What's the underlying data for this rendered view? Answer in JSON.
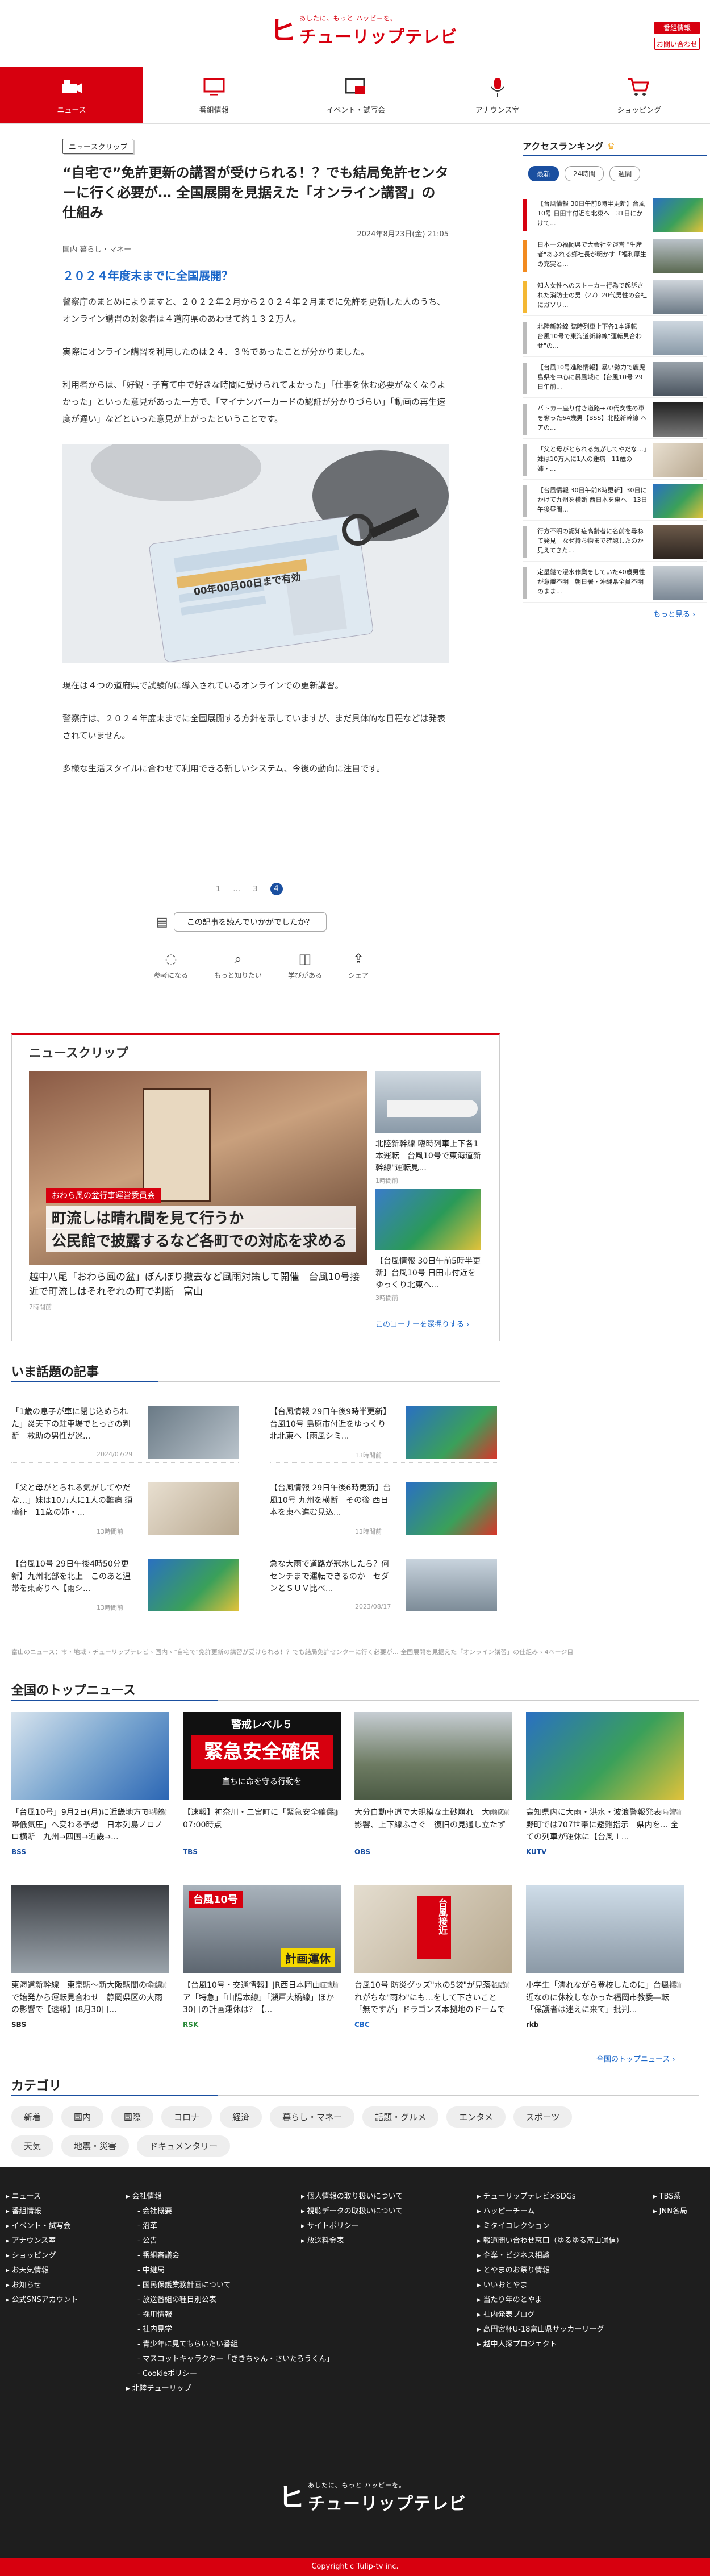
{
  "header": {
    "tagline": "あしたに、もっと ハッピーを。",
    "logo": "チューリップテレビ",
    "btn_newmember": "番組情報",
    "btn_inquiry": "お問い合わせ"
  },
  "nav": [
    {
      "label": "ニュース",
      "icon": "camera-icon"
    },
    {
      "label": "番組情報",
      "icon": "tv-icon"
    },
    {
      "label": "イベント・試写会",
      "icon": "event-icon"
    },
    {
      "label": "アナウンス室",
      "icon": "microphone-icon"
    },
    {
      "label": "ショッピング",
      "icon": "cart-icon"
    }
  ],
  "article": {
    "badge": "ニュースクリップ",
    "title": "“自宅で”免許更新の講習が受けられる！？でも結局免許センターに行く必要が… 全国展開を見据えた「オンライン講習」の仕組み",
    "date": "2024年8月23日(金) 21:05",
    "categories": "国内  暮らし・マネー",
    "subheading": "２０２４年度末までに全国展開？",
    "p1": "警察庁のまとめによりますと、２０２２年２月から２０２４年２月までに免許を更新した人のうち、オンライン講習の対象者は４道府県のあわせて約１３２万人。",
    "p2": "実際にオンライン講習を利用したのは２４．３％であったことが分かりました。",
    "p3": "利用者からは、「好観・子育て中で好きな時間に受けられてよかった」「仕事を休む必要がなくなりよかった」といった意見があった一方で、「マイナンバーカードの認証が分かりづらい」「動画の再生速度が遅い」などといった意見が上がったということです。",
    "p4": "現在は４つの道府県で試験的に導入されているオンラインでの更新講習。",
    "p5": "警察庁は、２０２４年度末までに全国展開する方針を示していますが、まだ具体的な日程などは発表されていません。",
    "p6": "多様な生活スタイルに合わせて利用できる新しいシステム、今後の動向に注目です。",
    "license_text": "00年00月00日まで有効"
  },
  "pager": {
    "p1": "1",
    "dots": "…",
    "p3": "3",
    "p4": "4"
  },
  "feedback": {
    "question": "この記事を読んでいかがでしたか？",
    "reactions": [
      {
        "label": "参考になる",
        "icon": "lightbulb-icon"
      },
      {
        "label": "もっと知りたい",
        "icon": "magnifier-icon"
      },
      {
        "label": "学びがある",
        "icon": "book-icon"
      },
      {
        "label": "シェア",
        "icon": "share-icon"
      }
    ]
  },
  "clip": {
    "title": "ニュースクリップ",
    "main_overlay_tag": "おわら風の盆行事運営委員会",
    "main_overlay1": "町流しは晴れ間を見て行うか",
    "main_overlay2": "公民館で披露するなど各町での対応を求める",
    "main_caption": "越中八尾「おわら風の盆」ぼんぼり撤去など風雨対策して開催　台風10号接近で町流しはそれぞれの町で判断　富山",
    "main_ts": "7時間前",
    "side1_caption": "北陸新幹線 臨時列車上下各1本運転　台風10号で東海道新幹線\"運転見...",
    "side1_ts": "1時間前",
    "side2_caption": "【台風情報 30日午前5時半更新】台風10号 日田市付近をゆっくり北東へ...",
    "side2_ts": "3時間前",
    "more": "このコーナーを深掘りする ›"
  },
  "trending": {
    "title": "いま話題の記事",
    "items": [
      {
        "t": "「1歳の息子が車に閉じ込められた」炎天下の駐車場でとっさの判断　救助の男性が迷...",
        "ts": "2024/07/29"
      },
      {
        "t": "【台風情報 29日午後9時半更新】台風10号 島原市付近をゆっくり北北東へ【雨風シミ...",
        "ts": "13時間前"
      },
      {
        "t": "「父と母がとられる気がしてやだな…」妹は10万人に1人の難病 須藤征　11歳の姉・...",
        "ts": "13時間前"
      },
      {
        "t": "【台風情報 29日午後6時更新】台風10号 九州を横断　その後 西日本を東へ進む見込...",
        "ts": "13時間前"
      },
      {
        "t": "【台風10号 29日午後4時50分更新】九州北部を北上　このあと温帯を東寄りへ【雨シ...",
        "ts": "13時間前"
      },
      {
        "t": "急な大雨で道路が冠水したら？何センチまで運転できるのか　セダンとＳＵＶ比べ...",
        "ts": "2023/08/17"
      }
    ]
  },
  "breadcrumb": "富山のニュース：市・地域 › チューリップテレビ › 国内 › \"自宅で\"免許更新の講習が受けられる！？でも結局免許センターに行く必要が… 全国展開を見据えた「オンライン講習」の仕組み › 4ページ目",
  "topnews": {
    "title": "全国のトップニュース",
    "items": [
      {
        "t": "「台風10号」9月2日(月)に近畿地方で「熱帯低気圧」へ変わる予想　日本列島ノロノロ横断　九州→四国→近畿→...",
        "src": "BSS",
        "ts": "3時間前"
      },
      {
        "t": "【速報】神奈川・二宮町に「緊急安全確保」07:00時点",
        "src": "TBS",
        "ts": "2時間前",
        "overlay1": "警戒レベル５",
        "overlay2": "緊急安全確保",
        "overlay3": "直ちに命を守る行動を"
      },
      {
        "t": "大分自動車道で大規模な土砂崩れ　大雨の影響、上下線ふさぐ　復旧の見通し立たず",
        "src": "OBS",
        "ts": "1時間前"
      },
      {
        "t": "高知県内に大雨・洪水・波浪警報発表 - 津野町では707世帯に避難指示　県内を... 全ての列車が運休に【台風１...",
        "src": "KUTV",
        "ts": "1時間前"
      },
      {
        "t": "東海道新幹線　東京駅〜新大阪駅間の全線で始発から運転見合わせ　静岡県区の大雨の影響で【速報】(8月30日...",
        "src": "SBS",
        "ts": "1時間前"
      },
      {
        "t": "【台風10号・交通情報】JR西日本岡山エリア「特急」「山陽本線」「瀬戸大橋線」ほか　30日の計画運休は？【...",
        "src": "RSK",
        "ts": "1時間前",
        "overlay1": "台風10号",
        "overlay2": "計画運休"
      },
      {
        "t": "台風10号 防災グッズ\"水の5袋\"が見落とされがちな\"雨わ\"にも…をして下さいこと「無ですが」ドラゴンズ本拠地のドームでも対策...",
        "src": "CBC",
        "ts": "1時間前",
        "overlay1": "台風接近"
      },
      {
        "t": "小学生「濡れながら登校したのに」台風接近なのに休校しなかった福岡市教委―転「保護者は迷えに来て」批判...",
        "src": "rkb",
        "ts": "1時間前"
      }
    ],
    "more": "全国のトップニュース ›"
  },
  "categories": {
    "title": "カテゴリ",
    "chips": [
      "新着",
      "国内",
      "国際",
      "コロナ",
      "経済",
      "暮らし・マネー",
      "話題・グルメ",
      "エンタメ",
      "スポーツ",
      "天気",
      "地震・災害",
      "ドキュメンタリー"
    ]
  },
  "ranking": {
    "title": "アクセスランキング",
    "tabs": [
      "最新",
      "24時間",
      "週間"
    ],
    "items": [
      {
        "t": "【台風情報 30日午前8時半更新】台風10号 日田市付近を北東へ　31日にかけて...",
        "color": "#d7000f"
      },
      {
        "t": "日本一の福岡県で大会社を運営 \"生産者\"あふれる郷社長が明かす「福利厚生の充実と...",
        "color": "#f28a1f"
      },
      {
        "t": "知人女性へのストーカー行為で起訴された消防士の男（27）20代男性の会社にガソリ...",
        "color": "#f4b833"
      },
      {
        "t": "北陸新幹線 臨時列車上下各1本運転　台風10号で東海道新幹線\"運転見合わせ\"の...",
        "color": "#aaa"
      },
      {
        "t": "【台風10号進路情報】暴い勢力で鹿児島県を中心に暴風域に【台風10号 29日午前...",
        "color": "#aaa"
      },
      {
        "t": "バトカー座り付き道路→70代女性の車を奪った64歳男【BSS】北陸新幹線 ペアの...",
        "color": "#aaa"
      },
      {
        "t": "「父と母がとられる気がしてやだな…」妹は10万人に1人の難病　11歳の姉・...",
        "color": "#aaa"
      },
      {
        "t": "【台風情報 30日午前8時更新】30日にかけて九州を横断 西日本を東へ　13日午後昼間...",
        "color": "#aaa"
      },
      {
        "t": "行方不明の認知症高齢者に名前を尋ねて発見　なぜ持ち物まで確認したのか　見えてきた...",
        "color": "#aaa"
      },
      {
        "t": "定量継で浸水作業をしていた40歳男性が意識不明　朝日署・沖縄県全員不明のまま...",
        "color": "#aaa"
      }
    ],
    "more": "もっと見る ›"
  },
  "footer": {
    "col1": [
      "ニュース",
      "番組情報",
      "イベント・試写会",
      "アナウンス室",
      "ショッピング",
      "お天気情報",
      "お知らせ",
      "公式SNSアカウント"
    ],
    "col2_head": "会社情報",
    "col2": [
      "会社概要",
      "沿革",
      "公告",
      "番組審議会",
      "中継局",
      "国民保護業務計画について",
      "放送番組の種目別公表",
      "採用情報",
      "社内見学",
      "青少年に見てもらいたい番組",
      "マスコットキャラクター「ききちゃん・さいたろうくん」",
      "Cookieポリシー"
    ],
    "col2_last": "北陸チューリップ",
    "col3": [
      "個人情報の取り扱いについて",
      "視聴データの取扱いについて",
      "サイトポリシー",
      "放送料金表"
    ],
    "col4": [
      "チューリップテレビ×SDGs",
      "ハッピーチーム",
      "ミタイコレクション",
      "報道問い合わせ窓口（ゆるゆる富山通信）",
      "企業・ビジネス相談",
      "とやまのお祭り情報",
      "いいおとやま",
      "当たり年のとやま",
      "社内発表ブログ",
      "高円宮杯U-18富山県サッカーリーグ",
      "越中人探プロジェクト"
    ],
    "col5": [
      "TBS系",
      "JNN各局"
    ],
    "tagline": "あしたに、もっと ハッピーを。",
    "logo": "チューリップテレビ",
    "copyright": "Copyright c Tulip-tv inc."
  }
}
